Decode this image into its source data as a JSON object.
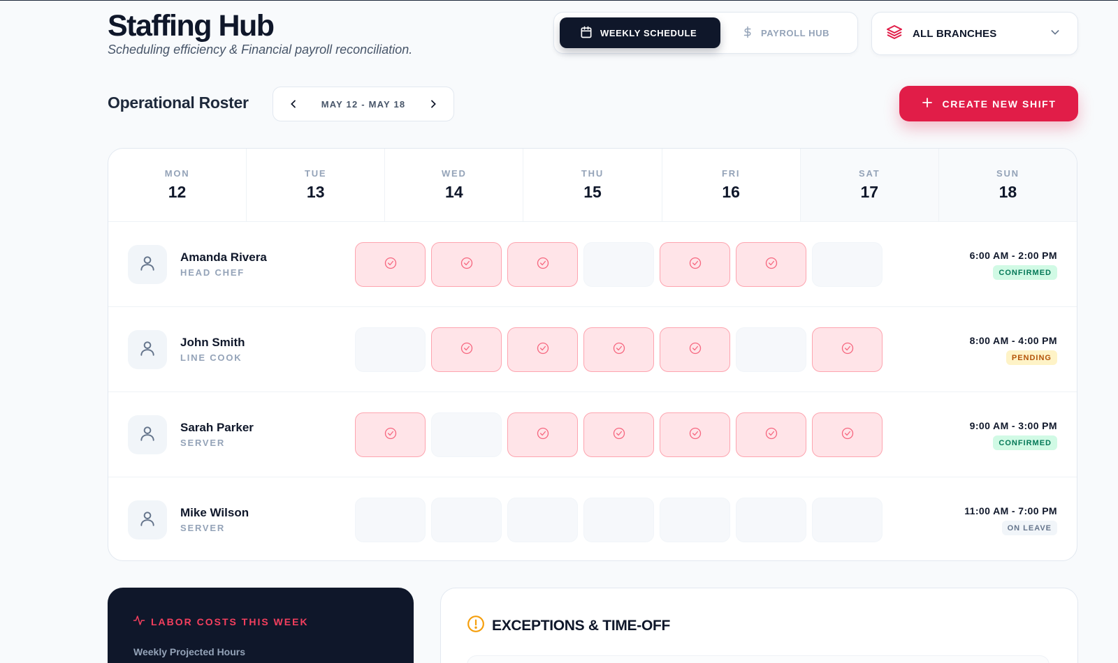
{
  "header": {
    "title": "Staffing Hub",
    "subtitle": "Scheduling efficiency & Financial payroll reconciliation."
  },
  "view_toggle": {
    "weekly_label": "WEEKLY SCHEDULE",
    "payroll_label": "PAYROLL HUB",
    "active": "weekly"
  },
  "branch_select": {
    "value": "ALL BRANCHES"
  },
  "roster": {
    "title": "Operational Roster",
    "week_range": "MAY 12 - MAY 18",
    "create_label": "CREATE NEW SHIFT"
  },
  "days": [
    {
      "name": "MON",
      "date": "12"
    },
    {
      "name": "TUE",
      "date": "13"
    },
    {
      "name": "WED",
      "date": "14"
    },
    {
      "name": "THU",
      "date": "15"
    },
    {
      "name": "FRI",
      "date": "16"
    },
    {
      "name": "SAT",
      "date": "17"
    },
    {
      "name": "SUN",
      "date": "18"
    }
  ],
  "employees": [
    {
      "name": "Amanda Rivera",
      "role": "HEAD CHEF",
      "shift": "6:00 AM - 2:00 PM",
      "status": "CONFIRMED",
      "status_type": "confirmed",
      "schedule": [
        true,
        true,
        true,
        false,
        true,
        true,
        false
      ]
    },
    {
      "name": "John Smith",
      "role": "LINE COOK",
      "shift": "8:00 AM - 4:00 PM",
      "status": "PENDING",
      "status_type": "pending",
      "schedule": [
        false,
        true,
        true,
        true,
        true,
        false,
        true
      ]
    },
    {
      "name": "Sarah Parker",
      "role": "SERVER",
      "shift": "9:00 AM - 3:00 PM",
      "status": "CONFIRMED",
      "status_type": "confirmed",
      "schedule": [
        true,
        false,
        true,
        true,
        true,
        true,
        true
      ]
    },
    {
      "name": "Mike Wilson",
      "role": "SERVER",
      "shift": "11:00 AM - 7:00 PM",
      "status": "ON LEAVE",
      "status_type": "leave",
      "schedule": [
        false,
        false,
        false,
        false,
        false,
        false,
        false
      ]
    }
  ],
  "labor": {
    "title": "LABOR COSTS THIS WEEK",
    "subtitle": "Weekly Projected Hours"
  },
  "exceptions": {
    "title": "EXCEPTIONS & TIME-OFF"
  },
  "colors": {
    "accent": "#e11d48",
    "dark": "#0f172a",
    "shift_on": "#ffe4e8",
    "confirmed": "#047857",
    "pending": "#b45309"
  }
}
